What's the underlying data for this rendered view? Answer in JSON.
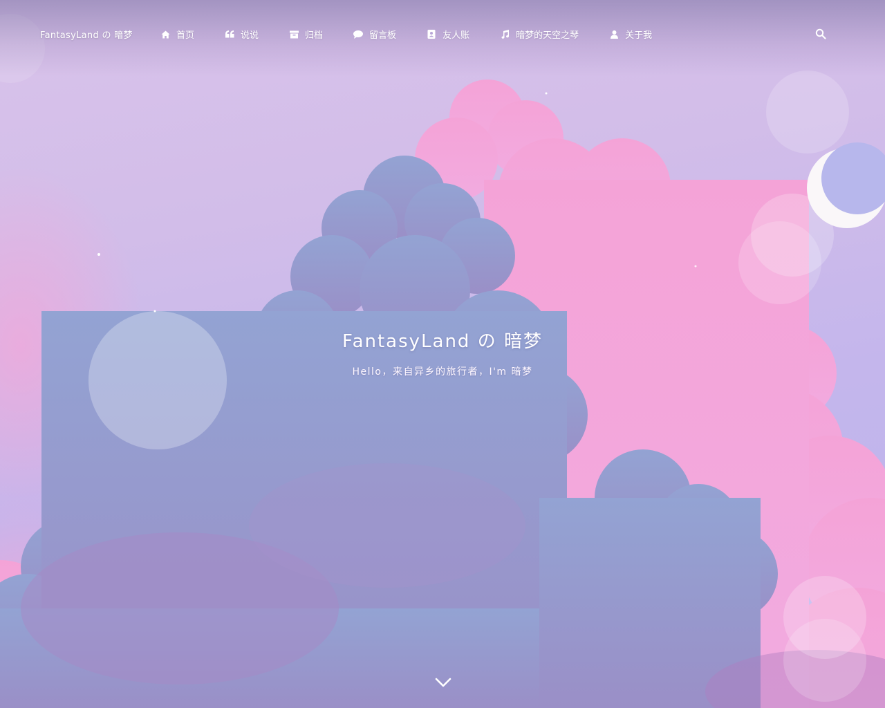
{
  "site": {
    "brand": "FantasyLand の 暗梦"
  },
  "nav": {
    "items": [
      {
        "label": "首页",
        "icon": "home-icon"
      },
      {
        "label": "说说",
        "icon": "quote-icon"
      },
      {
        "label": "归档",
        "icon": "archive-icon"
      },
      {
        "label": "留言板",
        "icon": "comment-icon"
      },
      {
        "label": "友人账",
        "icon": "address-book-icon"
      },
      {
        "label": "暗梦的天空之琴",
        "icon": "music-icon"
      },
      {
        "label": "关于我",
        "icon": "user-icon"
      }
    ],
    "search_icon": "search-icon"
  },
  "hero": {
    "title": "FantasyLand の 暗梦",
    "subtitle": "Hello，来自异乡的旅行者，I'm 暗梦",
    "scroll_icon": "chevron-down-icon"
  },
  "colors": {
    "sky_top": "#d9c3ea",
    "sky_right": "#b9b3ec",
    "cloud_pink": "#f7a9d9",
    "cloud_blue": "#95a3d1",
    "cloud_purple": "#a08cc4",
    "moon": "#faf7f9"
  }
}
